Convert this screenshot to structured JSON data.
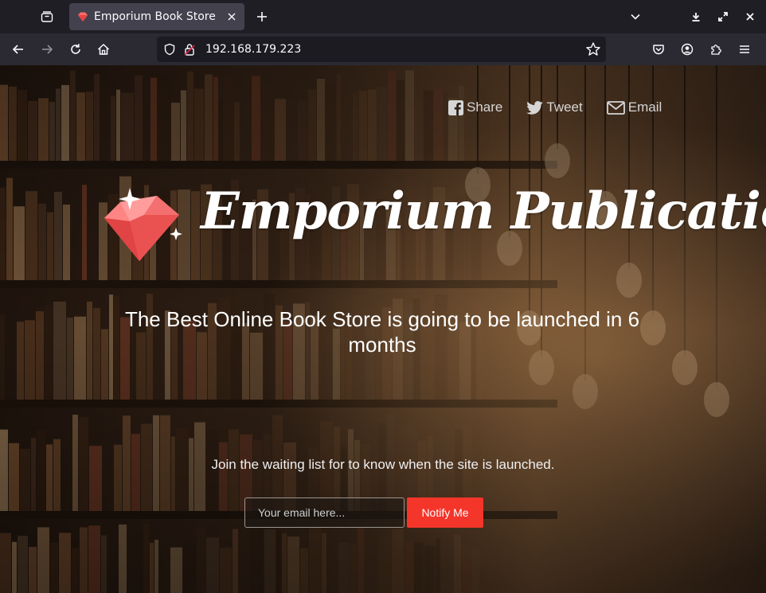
{
  "browser": {
    "tab": {
      "title": "Emporium Book Store"
    },
    "url": "192.168.179.223",
    "icons": {
      "tab_list": "tab-list-icon",
      "favicon": "ruby-gem-icon",
      "close": "close-icon",
      "new_tab": "plus-icon",
      "tabs_menu": "chevron-down-icon",
      "back": "arrow-left-icon",
      "forward": "arrow-right-icon",
      "reload": "reload-icon",
      "home": "home-icon",
      "shield": "shield-icon",
      "lock": "insecure-lock-icon",
      "bookmark": "star-icon",
      "pocket": "pocket-icon",
      "account": "account-icon",
      "extensions": "puzzle-icon",
      "menu": "hamburger-menu-icon",
      "download": "download-icon",
      "maximize": "maximize-icon",
      "window_close": "window-close-icon"
    }
  },
  "page": {
    "share": [
      {
        "label": "Share",
        "icon": "facebook-icon"
      },
      {
        "label": "Tweet",
        "icon": "twitter-icon"
      },
      {
        "label": "Email",
        "icon": "envelope-icon"
      }
    ],
    "brand": "Emporium Publications",
    "tagline": "The Best Online Book Store is going to be launched in 6 months",
    "waitlist_text": "Join the waiting list for to know when the site is launched.",
    "email_placeholder": "Your email here...",
    "notify_label": "Notify Me",
    "colors": {
      "accent": "#f4352a",
      "gem": "#f25a5a",
      "text": "#ffffff",
      "chrome_dark": "#1f1e25",
      "chrome_toolbar": "#2b2a33"
    }
  }
}
